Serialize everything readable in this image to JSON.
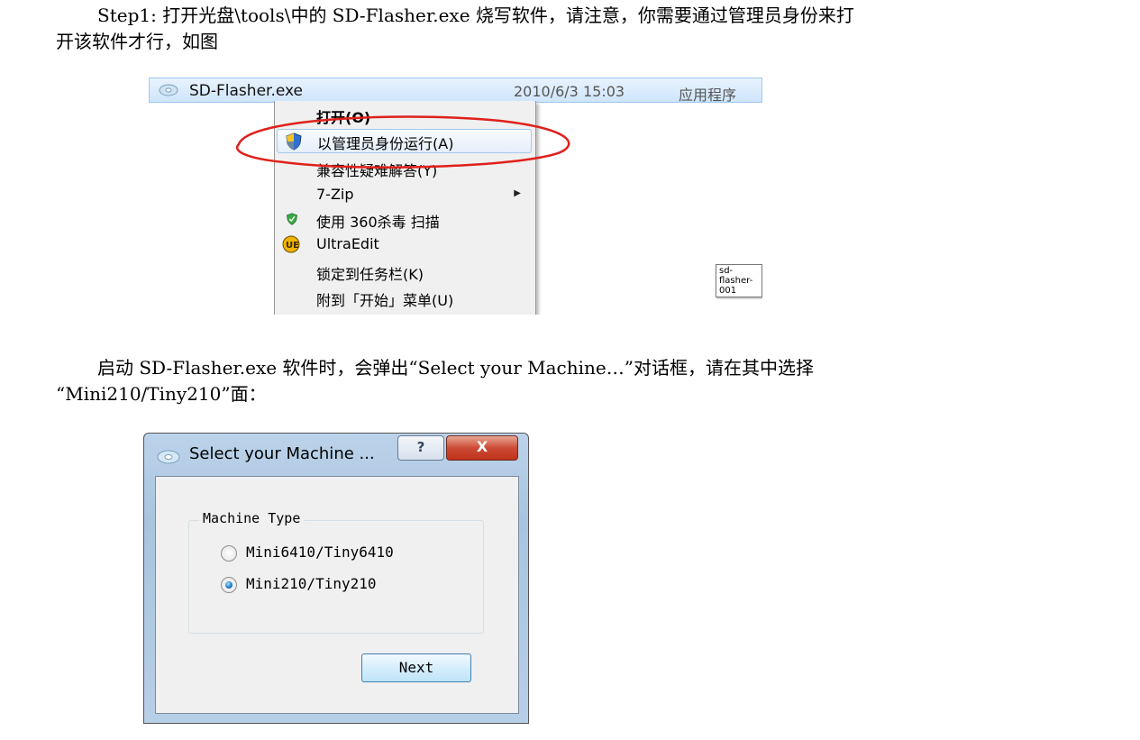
{
  "document": {
    "para1_line1": "Step1: 打开光盘\\tools\\中的 SD-Flasher.exe 烧写软件，请注意，你需要通过管理员身份来打",
    "para1_line2": "开该软件才行，如图",
    "para2_line1": "启动 SD-Flasher.exe 软件时，会弹出“Select your Machine…”对话框，请在其中选择",
    "para2_line2": "“Mini210/Tiny210”面："
  },
  "explorer": {
    "file": {
      "name": "SD-Flasher.exe",
      "modified": "2010/6/3 15:03",
      "type": "应用程序"
    },
    "tooltip": "sd-flasher-001"
  },
  "context_menu": {
    "items": [
      {
        "label": "打开(O)",
        "icon": "none",
        "highlighted": false
      },
      {
        "label": "以管理员身份运行(A)",
        "icon": "uac-shield-icon",
        "highlighted": true
      },
      {
        "label": "兼容性疑难解答(Y)",
        "icon": "none",
        "highlighted": false
      },
      {
        "label": "7-Zip",
        "icon": "none",
        "submenu": true
      },
      {
        "label": "使用 360杀毒 扫描",
        "icon": "360-shield-icon"
      },
      {
        "label": "UltraEdit",
        "icon": "ultraedit-icon"
      },
      {
        "label": "锁定到任务栏(K)",
        "icon": "none"
      },
      {
        "label": "附到「开始」菜单(U)",
        "icon": "none"
      }
    ],
    "annotation_color": "#e0201b"
  },
  "dialog": {
    "title": "Select your Machine ...",
    "help_label": "?",
    "close_label": "X",
    "group_label": "Machine Type",
    "options": [
      {
        "label": "Mini6410/Tiny6410",
        "selected": false
      },
      {
        "label": "Mini210/Tiny210",
        "selected": true
      }
    ],
    "next_label": "Next"
  }
}
